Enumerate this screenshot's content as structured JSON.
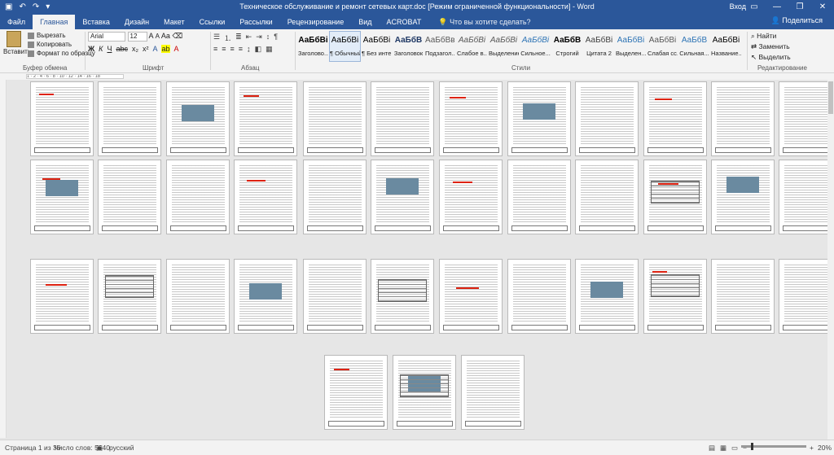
{
  "window": {
    "title": "Техническое обслуживание и ремонт сетевых карт.doc [Режим ограниченной функциональности] - Word",
    "login": "Вход",
    "controls": [
      "—",
      "❐",
      "✕"
    ]
  },
  "ribbon": {
    "tabs": [
      "Файл",
      "Главная",
      "Вставка",
      "Дизайн",
      "Макет",
      "Ссылки",
      "Рассылки",
      "Рецензирование",
      "Вид",
      "ACROBAT"
    ],
    "active_tab": "Главная",
    "tell_me": "Что вы хотите сделать?",
    "share": "Поделиться",
    "clipboard": {
      "paste": "Вставить",
      "cut": "Вырезать",
      "copy": "Копировать",
      "format_painter": "Формат по образцу",
      "label": "Буфер обмена"
    },
    "font": {
      "name": "Arial",
      "size": "12",
      "label": "Шрифт"
    },
    "paragraph": {
      "label": "Абзац"
    },
    "styles": {
      "label": "Стили",
      "items": [
        {
          "sample": "АаБбВі",
          "name": "Заголово..."
        },
        {
          "sample": "АаБбВі",
          "name": "¶ Обычный"
        },
        {
          "sample": "АаБбВі",
          "name": "¶ Без инте..."
        },
        {
          "sample": "АаБбВ",
          "name": "Заголовок"
        },
        {
          "sample": "АаБбВвГ",
          "name": "Подзагол..."
        },
        {
          "sample": "АаБбВі",
          "name": "Слабое в..."
        },
        {
          "sample": "АаБбВі",
          "name": "Выделение"
        },
        {
          "sample": "АаБбВі",
          "name": "Сильное..."
        },
        {
          "sample": "АаБбВ",
          "name": "Строгий"
        },
        {
          "sample": "АаБбВі",
          "name": "Цитата 2"
        },
        {
          "sample": "АаБбВі",
          "name": "Выделен..."
        },
        {
          "sample": "АаБбВі",
          "name": "Слабая сс..."
        },
        {
          "sample": "АаБбВ",
          "name": "Сильная..."
        },
        {
          "sample": "АаБбВі",
          "name": "Название..."
        }
      ]
    },
    "editing": {
      "find": "Найти",
      "replace": "Заменить",
      "select": "Выделить",
      "label": "Редактирование"
    }
  },
  "ruler_text": "1 · 2 · 4 · 6 · 8 · 10 · 12 · 14 · 16 · 18",
  "status": {
    "page": "Страница 1 из 36",
    "words": "Число слов: 5640",
    "language": "русский",
    "zoom": "20%"
  }
}
